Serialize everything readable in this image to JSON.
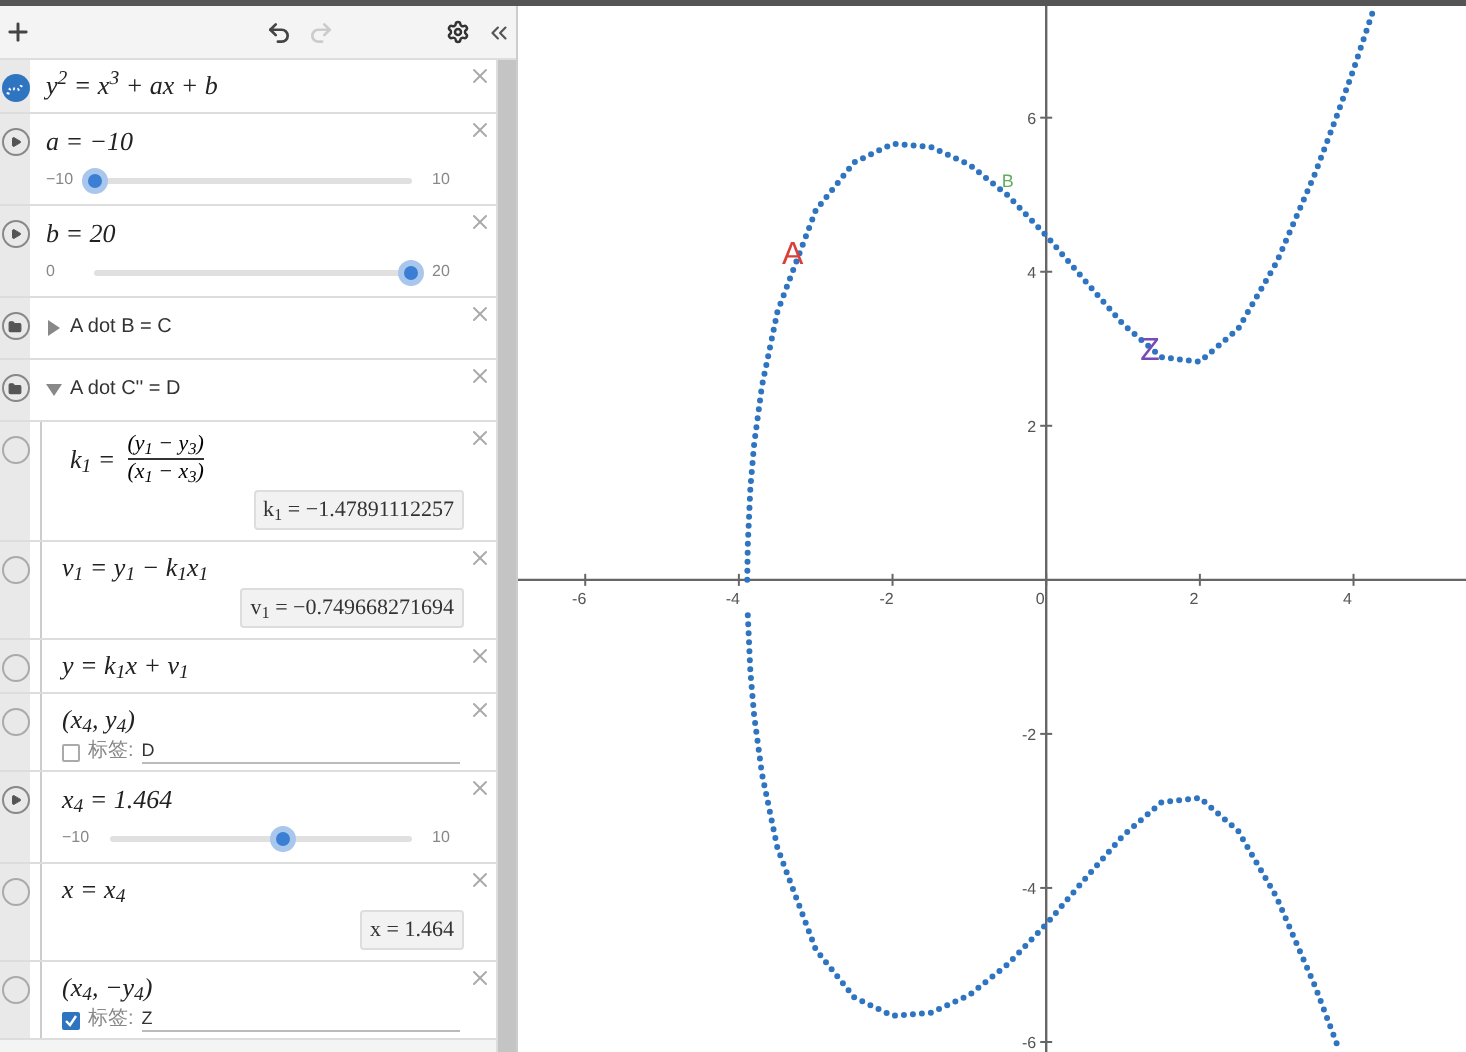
{
  "toolbar": {
    "undo_disabled": false,
    "redo_disabled": true
  },
  "expressions": [
    {
      "kind": "equation",
      "expr": "y$^{2}$ = x$^{3}$ + ax + b"
    },
    {
      "kind": "slider",
      "expr": "a = −10",
      "min": "−10",
      "max": "10",
      "level": 0
    },
    {
      "kind": "slider",
      "expr": "b = 20",
      "min": "0",
      "max": "20",
      "level": 1
    },
    {
      "kind": "folder",
      "title": "A dot B = C",
      "expanded": false
    },
    {
      "kind": "folder",
      "title": "A dot C'' = D",
      "expanded": true,
      "children": [
        {
          "kind": "fraction",
          "lhs": "k$_{1}$ =",
          "numerator": "(y$_{1}$ − y$_{3}$)",
          "denominator": "(x$_{1}$ − x$_{3}$)",
          "result": "k$_{1}$ = −1.47891112257"
        },
        {
          "kind": "equation",
          "expr": "v$_{1}$ = y$_{1}$ − k$_{1}$x$_{1}$",
          "result": "v$_{1}$ = −0.749668271694"
        },
        {
          "kind": "equation",
          "expr": "y = k$_{1}$x + v$_{1}$"
        },
        {
          "kind": "point",
          "expr": "(x$_{4}$, y$_{4}$)",
          "label_checked": false,
          "label_prefix": "标签:",
          "label_value": "D"
        },
        {
          "kind": "slider",
          "expr": "x$_{4}$ = 1.464",
          "min": "−10",
          "max": "10",
          "level": 0.573
        },
        {
          "kind": "equation",
          "expr": "x = x$_{4}$",
          "result": "x = 1.464"
        },
        {
          "kind": "point",
          "expr": "(x$_{4}$, −y$_{4}$)",
          "label_checked": true,
          "label_prefix": "标签:",
          "label_value": "Z"
        }
      ]
    }
  ],
  "graph": {
    "chart_data": {
      "type": "line",
      "xlim": [
        -6.875,
        5.49
      ],
      "ylim": [
        -6.13,
        7.45
      ],
      "xticks": [
        -6,
        -4,
        -2,
        0,
        2,
        4
      ],
      "yticks": [
        -6,
        -4,
        -2,
        2,
        4,
        6
      ],
      "x": [
        -3.891,
        -3.885,
        -3.85,
        -3.8,
        -3.7,
        -3.5,
        -3,
        -2.5,
        -2,
        -1.5,
        -1,
        -0.5,
        0,
        0.5,
        1,
        1.5,
        2,
        2.5,
        3,
        3.5,
        3.8,
        4,
        4.27
      ],
      "series": [
        {
          "color": "#2f74c0",
          "line_style": "dotted",
          "values": [
            0,
            0.46,
            1.2,
            1.77,
            2.52,
            3.48,
            4.8,
            5.42,
            5.66,
            5.62,
            5.39,
            4.99,
            4.47,
            3.89,
            3.32,
            2.89,
            2.83,
            3.26,
            4.12,
            5.28,
            6.07,
            6.63,
            7.43
          ]
        },
        {
          "color": "#2f74c0",
          "line_style": "dotted",
          "values": [
            null,
            -0.46,
            -1.2,
            -1.77,
            -2.52,
            -3.48,
            -4.8,
            -5.42,
            -5.66,
            -5.62,
            -5.39,
            -4.99,
            -4.47,
            -3.89,
            -3.32,
            -2.89,
            -2.83,
            -3.26,
            -4.12,
            -5.28,
            -6.07,
            null,
            null
          ]
        }
      ],
      "annotations": [
        {
          "text": "A",
          "x": -3.3,
          "y": 4.1
        },
        {
          "text": "B",
          "x": -0.5,
          "y": 5.1
        },
        {
          "text": "Z",
          "x": 1.35,
          "y": 2.85
        }
      ]
    }
  }
}
